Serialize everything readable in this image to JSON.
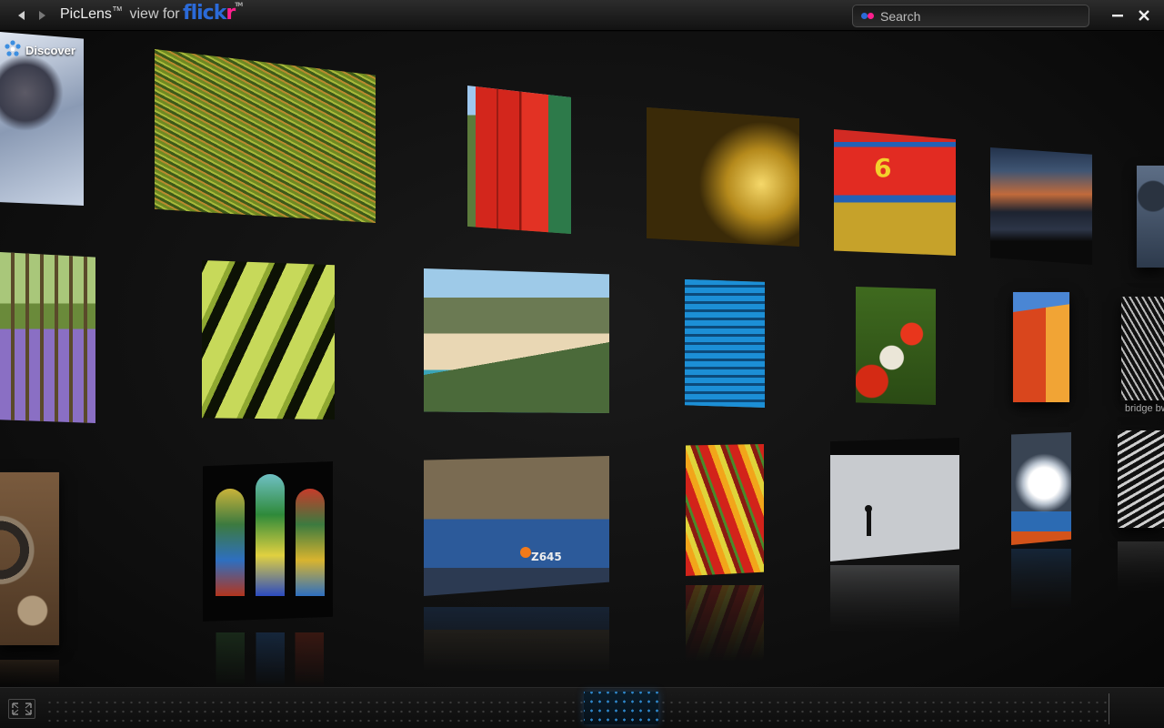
{
  "titlebar": {
    "app_name": "PicLens",
    "trademark": "TM",
    "view_for": "view for",
    "service_logo": "flickr",
    "service_logo_tm": "TM"
  },
  "search": {
    "placeholder": "Search",
    "value": ""
  },
  "wall": {
    "discover_label": "Discover"
  },
  "photos": [
    {
      "caption": "bridge bw"
    }
  ],
  "colors": {
    "flickr_blue": "#2b6ad8",
    "flickr_pink": "#ff1f8e",
    "scrubber_active": "#2e86c9"
  },
  "icons": [
    "back-arrow-icon",
    "forward-arrow-icon",
    "flickr-dots-icon",
    "minimize-icon",
    "close-icon",
    "discover-icon",
    "fullscreen-icon"
  ]
}
